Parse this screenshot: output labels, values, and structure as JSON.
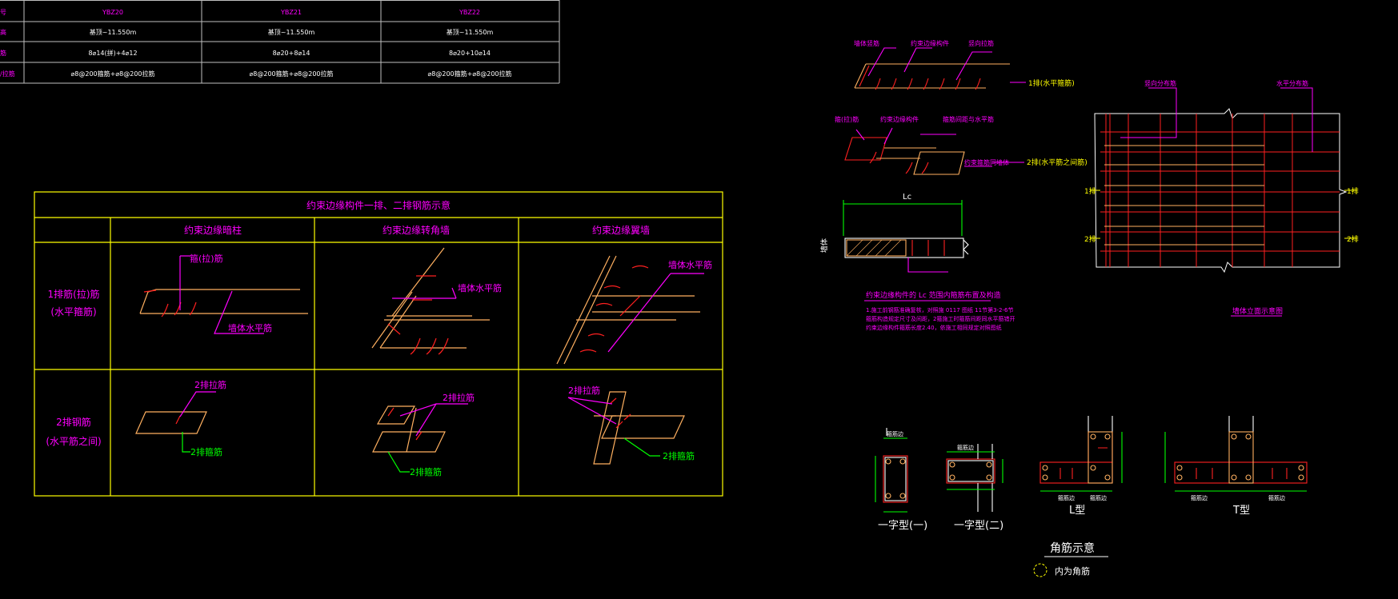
{
  "colors": {
    "background": "#000000",
    "table_grid": "#bfbfbf",
    "yellow": "#ffff00",
    "magenta": "#ff00ff",
    "green": "#00ff00",
    "red": "#ff2020",
    "orange": "#ffb060",
    "white": "#ffffff"
  },
  "top_table": {
    "row_labels": [
      "号",
      "高",
      "筋",
      "/拉筋"
    ],
    "columns": [
      {
        "name": "YBZ20",
        "elevation": "基顶~11.550m",
        "rebar": "8⌀14(拼)+4⌀12",
        "stirrup": "⌀8@200箍筋+⌀8@200拉筋"
      },
      {
        "name": "YBZ21",
        "elevation": "基顶~11.550m",
        "rebar": "8⌀20+8⌀14",
        "stirrup": "⌀8@200箍筋+⌀8@200拉筋"
      },
      {
        "name": "YBZ22",
        "elevation": "基顶~11.550m",
        "rebar": "8⌀20+10⌀14",
        "stirrup": "⌀8@200箍筋+⌀8@200拉筋"
      }
    ]
  },
  "constraint_table": {
    "title": "约束边缘构件一排、二排钢筋示意",
    "col_headers": [
      "约束边缘暗柱",
      "约束边缘转角墙",
      "约束边缘翼墙"
    ],
    "row_headers": [
      [
        "1排筋(拉)筋",
        "(水平箍筋)"
      ],
      [
        "2排钢筋",
        "(水平筋之间)"
      ]
    ],
    "labels": {
      "stirrup_leg": "箍(拉)筋",
      "wall_horizontal": "墙体水平筋",
      "row2_tie": "2排拉筋",
      "row2_stirrup": "2排箍筋"
    }
  },
  "right_details": {
    "layer1_label": "1排(水平箍筋)",
    "layer2_label": "2排(水平筋之间筋)",
    "lc_label": "Lc",
    "wall_end_label": "墙体",
    "lc_caption": "约束边缘构件的 Lc 范围内箍筋布置及构造",
    "notes": [
      "1.施工前钢筋准确复核，对照施 0117 图纸 11节第3-2-6节",
      "箍筋构造规定尺寸及间距，2箍施工时箍筋间距同水平筋错开",
      "约束边缘构件箍筋长度2.40，依施工相同规定对照图纸"
    ],
    "wall_plan_caption": "墙体立面示意图",
    "wall_plan_top_left": "竖向分布筋",
    "wall_plan_top_right": "水平分布筋",
    "side_labels": [
      "1排",
      "2排"
    ],
    "small_top_labels": [
      "墙体竖筋",
      "约束边缘构件",
      "竖向拉筋"
    ],
    "small_mid_labels": [
      "箍(拉)筋",
      "约束边缘构件",
      "箍筋间距与水平筋",
      "约束箍筋同墙体"
    ]
  },
  "sections": {
    "shapes": [
      "一字型(一)",
      "一字型(二)",
      "L型",
      "T型"
    ],
    "dim_label": "箍筋边",
    "legend_title": "角筋示意",
    "legend_item": "内为角筋"
  }
}
